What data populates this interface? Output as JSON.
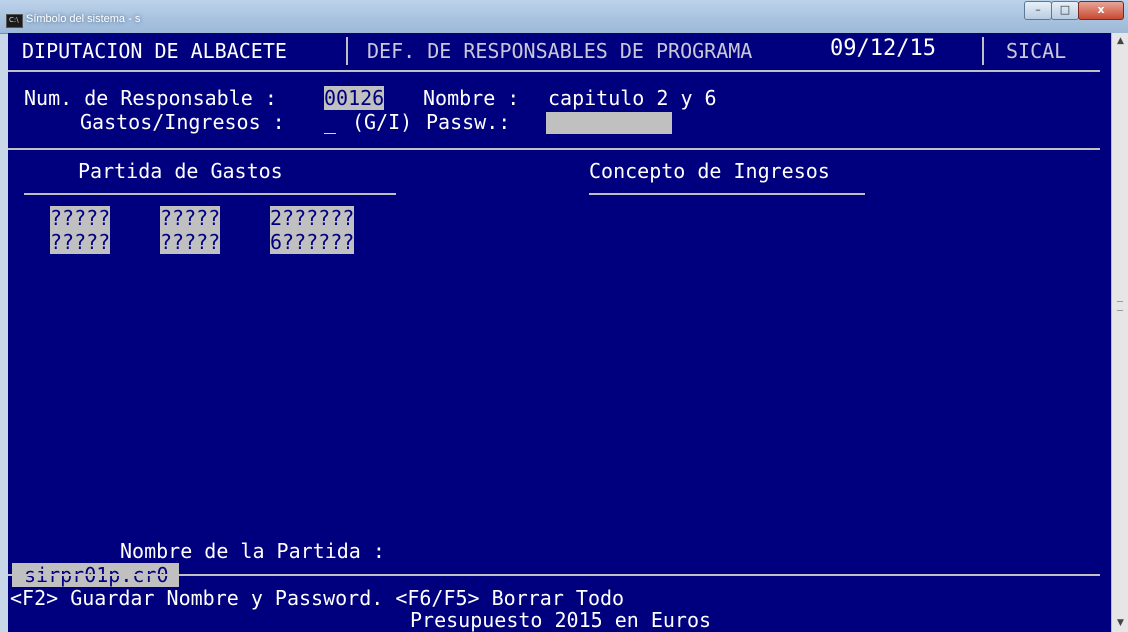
{
  "window": {
    "title": "Símbolo del sistema - s",
    "icon_text": "C:\\",
    "buttons": {
      "minimize": "–",
      "maximize": "□",
      "close": "x"
    }
  },
  "header": {
    "org": "DIPUTACION DE ALBACETE",
    "module": "DEF. DE RESPONSABLES DE PROGRAMA",
    "date": "09/12/15",
    "system": "SICAL"
  },
  "form": {
    "num_label": "Num. de Responsable :",
    "num_value": "00126",
    "nombre_label": "Nombre :",
    "nombre_value": "capitulo 2 y 6",
    "gastos_label": "Gastos/Ingresos :",
    "gastos_value": "_",
    "gastos_hint": "(G/I)",
    "passw_label": "Passw.:",
    "passw_value": ""
  },
  "sections": {
    "gastos_title": "Partida de Gastos",
    "ingresos_title": "Concepto de Ingresos"
  },
  "partidas": [
    {
      "a": "?????",
      "b": "?????",
      "c": "2??????"
    },
    {
      "a": "?????",
      "b": "?????",
      "c": "6??????"
    }
  ],
  "footer": {
    "nombre_partida_label": "Nombre de la Partida :",
    "program_file": "sirpr01p.cr0",
    "keys_line": "<F2> Guardar Nombre y Password. <F6/F5> Borrar Todo",
    "budget_line": "Presupuesto 2015 en Euros"
  },
  "colors": {
    "background": "#00007f",
    "text": "#ffffff",
    "highlight": "#c0c0c0"
  }
}
